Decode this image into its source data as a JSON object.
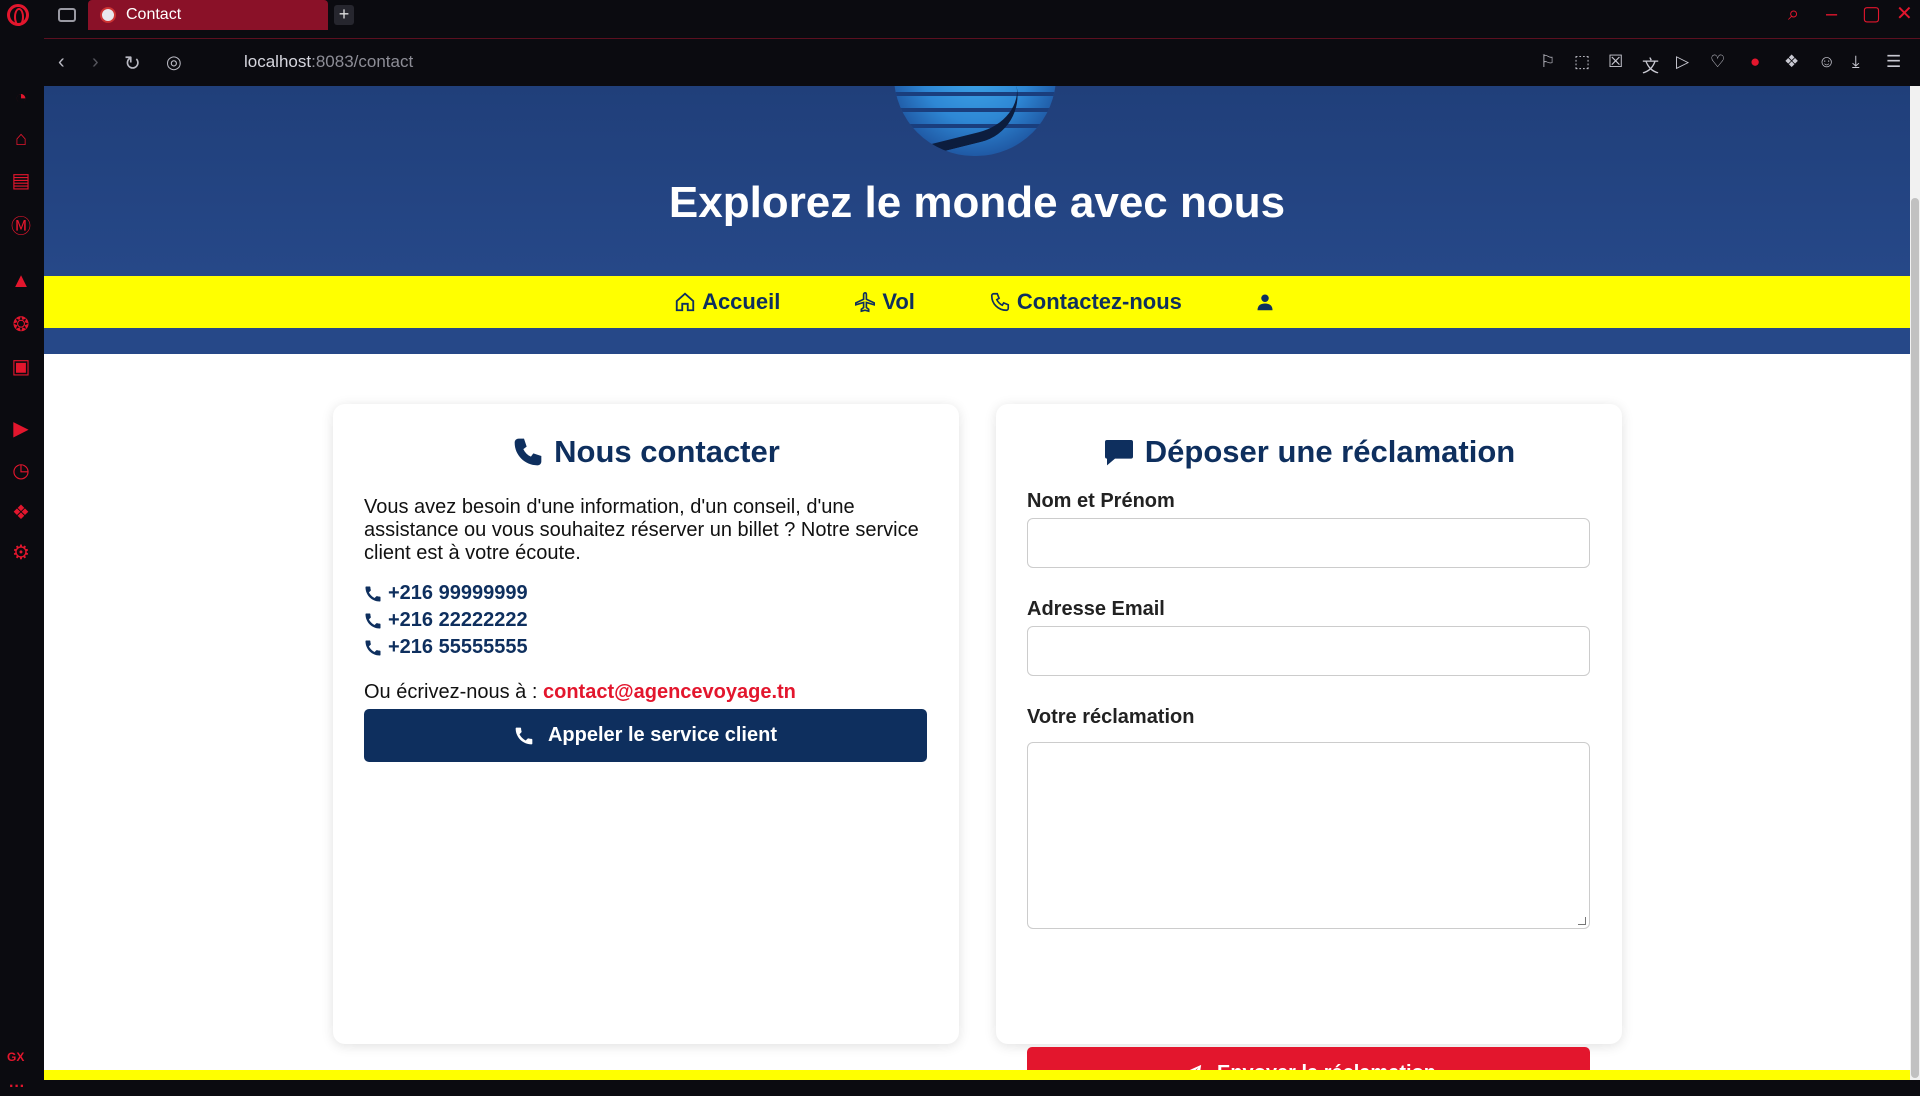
{
  "browser": {
    "tab_title": "Contact",
    "new_tab_label": "+",
    "url_host": "localhost",
    "url_rest": ":8083/contact",
    "sidebar_gx": "GX",
    "sidebar_more": "···"
  },
  "hero": {
    "title": "Explorez le monde avec nous"
  },
  "nav": {
    "items": [
      {
        "label": "Accueil",
        "icon": "home-icon"
      },
      {
        "label": "Vol",
        "icon": "plane-icon"
      },
      {
        "label": "Contactez-nous",
        "icon": "phone-icon"
      },
      {
        "label": "",
        "icon": "user-icon"
      }
    ]
  },
  "contact": {
    "title": "Nous contacter",
    "intro": "Vous avez besoin d'une information, d'un conseil, d'une assistance ou vous souhaitez réserver un billet ? Notre service client est à votre écoute.",
    "phones": [
      "+216 99999999",
      "+216 22222222",
      "+216 55555555"
    ],
    "write_prefix": "Ou écrivez-nous à :",
    "email": "contact@agencevoyage.tn",
    "call_button": "Appeler le service client"
  },
  "complaint": {
    "title": "Déposer une réclamation",
    "name_label": "Nom et Prénom",
    "email_label": "Adresse Email",
    "message_label": "Votre réclamation",
    "submit_button": "Envoyer la réclamation"
  },
  "colors": {
    "navy": "#0e2f5e",
    "accent_red": "#e3162d",
    "nav_yellow": "#ffff00",
    "hero_blue": "#264888"
  }
}
